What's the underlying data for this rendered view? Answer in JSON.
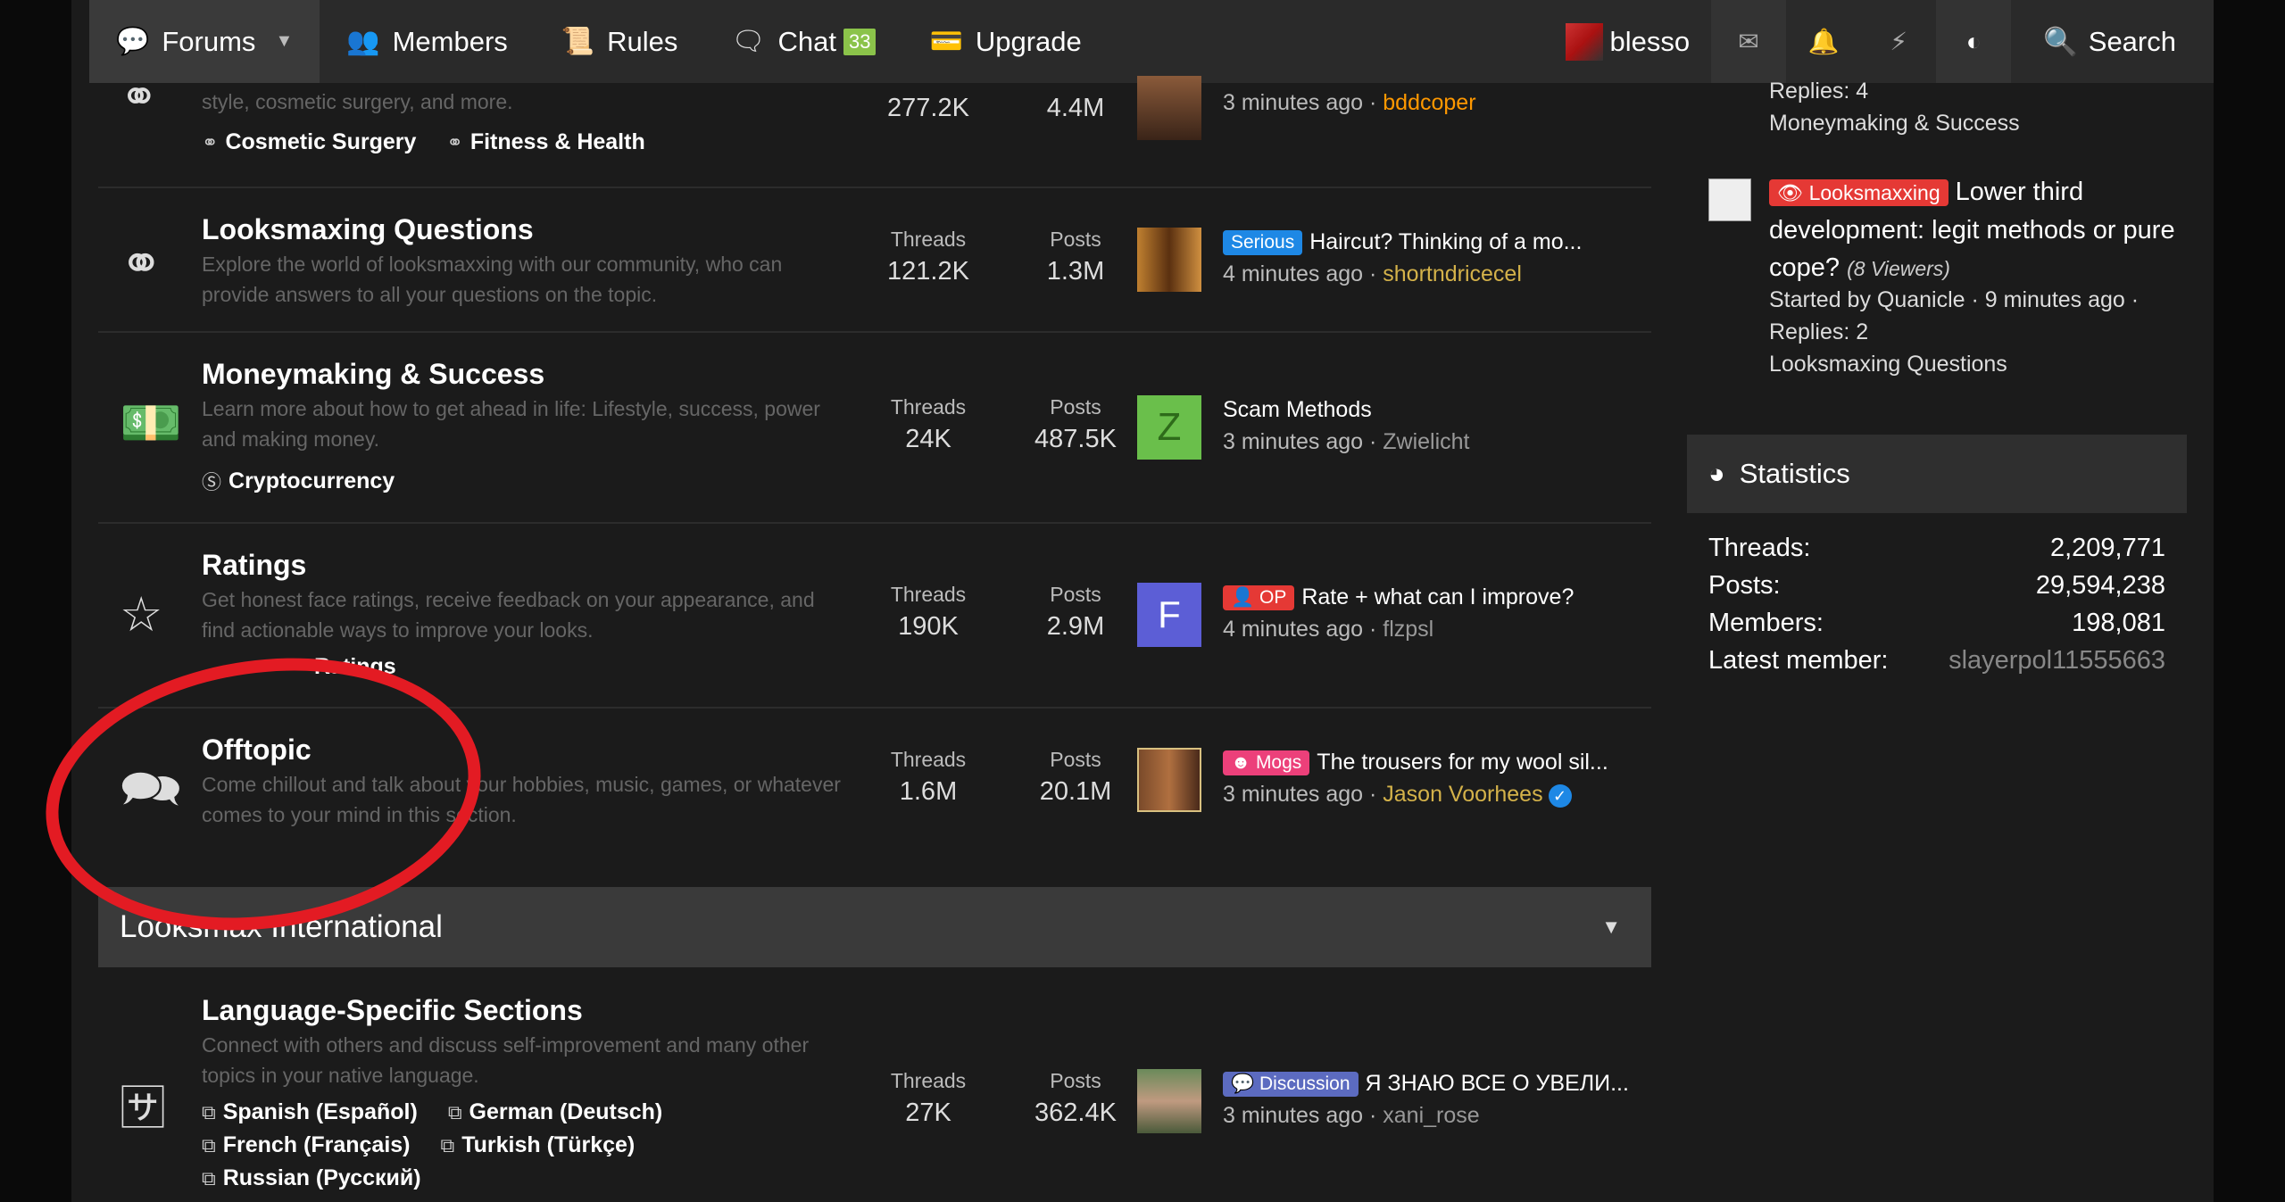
{
  "nav": {
    "forums": "Forums",
    "members": "Members",
    "rules": "Rules",
    "chat": "Chat",
    "chat_count": "33",
    "upgrade": "Upgrade",
    "username": "blesso",
    "search": "Search"
  },
  "forums": [
    {
      "name": "",
      "desc": "style, cosmetic surgery, and more.",
      "subforums": [
        "Cosmetic Surgery",
        "Fitness & Health"
      ],
      "threads": "277.2K",
      "posts": "4.4M",
      "last_title": "",
      "last_time": "3 minutes ago",
      "last_user": "bddcoper"
    },
    {
      "name": "Looksmaxing Questions",
      "desc": "Explore the world of looksmaxxing with our community, who can provide answers to all your questions on the topic.",
      "threads_label": "Threads",
      "threads": "121.2K",
      "posts_label": "Posts",
      "posts": "1.3M",
      "tag": "Serious",
      "last_title": "Haircut? Thinking of a mo...",
      "last_time": "4 minutes ago",
      "last_user": "shortndricecel"
    },
    {
      "name": "Moneymaking & Success",
      "desc": "Learn more about how to get ahead in life: Lifestyle, success, power and making money.",
      "subforums": [
        "Cryptocurrency"
      ],
      "threads_label": "Threads",
      "threads": "24K",
      "posts_label": "Posts",
      "posts": "487.5K",
      "avatar_letter": "Z",
      "last_title": "Scam Methods",
      "last_time": "3 minutes ago",
      "last_user": "Zwielicht"
    },
    {
      "name": "Ratings",
      "desc": "Get honest face ratings, receive feedback on your appearance, and find actionable ways to improve your looks.",
      "subforums": [
        "Ratings"
      ],
      "threads_label": "Threads",
      "threads": "190K",
      "posts_label": "Posts",
      "posts": "2.9M",
      "avatar_letter": "F",
      "tag": "OP",
      "last_title": "Rate + what can I improve?",
      "last_time": "4 minutes ago",
      "last_user": "flzpsl"
    },
    {
      "name": "Offtopic",
      "desc": "Come chillout and talk about your hobbies, music, games, or whatever comes to your mind in this section.",
      "threads_label": "Threads",
      "threads": "1.6M",
      "posts_label": "Posts",
      "posts": "20.1M",
      "tag": "Mogs",
      "last_title": "The trousers for my wool sil...",
      "last_time": "3 minutes ago",
      "last_user": "Jason Voorhees"
    }
  ],
  "section": {
    "title": "Looksmax International"
  },
  "language_forum": {
    "name": "Language-Specific Sections",
    "desc": "Connect with others and discuss self-improvement and many other topics in your native language.",
    "subforums": [
      "Spanish (Español)",
      "German (Deutsch)",
      "French (Français)",
      "Turkish (Türkçe)",
      "Russian (Русский)"
    ],
    "threads_label": "Threads",
    "threads": "27K",
    "posts_label": "Posts",
    "posts": "362.4K",
    "tag": "Discussion",
    "last_title": "Я ЗНАЮ ВСЕ О УВЕЛИ...",
    "last_time": "3 minutes ago",
    "last_user": "xani_rose"
  },
  "sidebar": {
    "prev_replies": "Replies: 4",
    "prev_forum": "Moneymaking & Success",
    "thread_tag": "Looksmaxxing",
    "thread_title": "Lower third development: legit methods or pure cope?",
    "thread_viewers": "(8 Viewers)",
    "thread_meta": "Started by Quanicle · 9 minutes ago ·",
    "thread_replies": "Replies: 2",
    "thread_forum": "Looksmaxing Questions"
  },
  "statistics": {
    "title": "Statistics",
    "threads_label": "Threads:",
    "threads": "2,209,771",
    "posts_label": "Posts:",
    "posts": "29,594,238",
    "members_label": "Members:",
    "members": "198,081",
    "latest_label": "Latest member:",
    "latest": "slayerpol11555663"
  },
  "colors": {
    "accent_green": "#8bc34a",
    "annotation_red": "#e31b23",
    "tag_blue": "#1e88e5",
    "tag_red": "#e53935",
    "tag_pink": "#ec407a",
    "tag_purple": "#5c6bc0"
  }
}
